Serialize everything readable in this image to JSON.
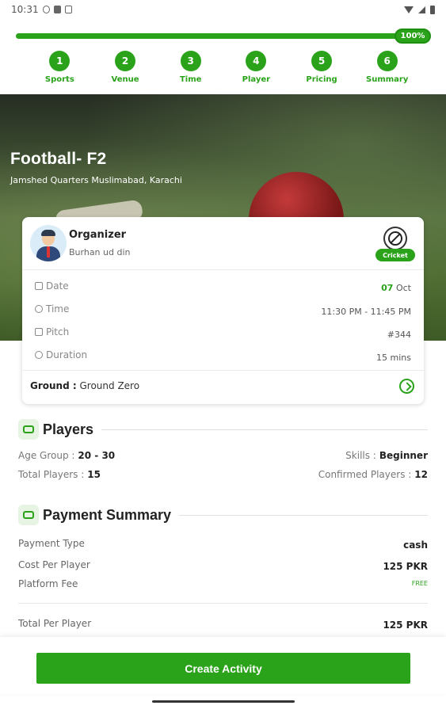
{
  "status_bar": {
    "time": "10:31"
  },
  "progress": {
    "value_percent": 100,
    "label": "100%"
  },
  "steps": [
    {
      "num": "1",
      "label": "Sports"
    },
    {
      "num": "2",
      "label": "Venue"
    },
    {
      "num": "3",
      "label": "Time"
    },
    {
      "num": "4",
      "label": "Player"
    },
    {
      "num": "5",
      "label": "Pricing"
    },
    {
      "num": "6",
      "label": "Summary"
    }
  ],
  "hero": {
    "title": "Football- F2",
    "address": "Jamshed Quarters Muslimabad, Karachi"
  },
  "card": {
    "organizer_label": "Organizer",
    "organizer_name": "Burhan ud din",
    "sport_badge": "Cricket",
    "date_label": "Date",
    "date_day": "07",
    "date_month": "Oct",
    "time_label": "Time",
    "time_value": "11:30 PM - 11:45 PM",
    "pitch_label": "Pitch",
    "pitch_value": "#344",
    "duration_label": "Duration",
    "duration_value": "15 mins",
    "ground_label": "Ground :",
    "ground_value": "Ground Zero"
  },
  "players": {
    "title": "Players",
    "age_group_label": "Age Group :",
    "age_group_value": "20 - 30",
    "total_players_label": "Total Players :",
    "total_players_value": "15",
    "skills_label": "Skills :",
    "skills_value": "Beginner",
    "confirmed_label": "Confirmed Players :",
    "confirmed_value": "12"
  },
  "payment": {
    "title": "Payment Summary",
    "payment_type_label": "Payment Type",
    "payment_type_value": "cash",
    "cost_label": "Cost Per Player",
    "cost_value": "125 PKR",
    "platform_fee_label": "Platform Fee",
    "platform_fee_value": "FREE",
    "total_label": "Total Per Player",
    "total_value": "125 PKR"
  },
  "actions": {
    "create_label": "Create Activity"
  },
  "colors": {
    "accent": "#2aa31a",
    "accent_dark": "#1f8f12"
  }
}
